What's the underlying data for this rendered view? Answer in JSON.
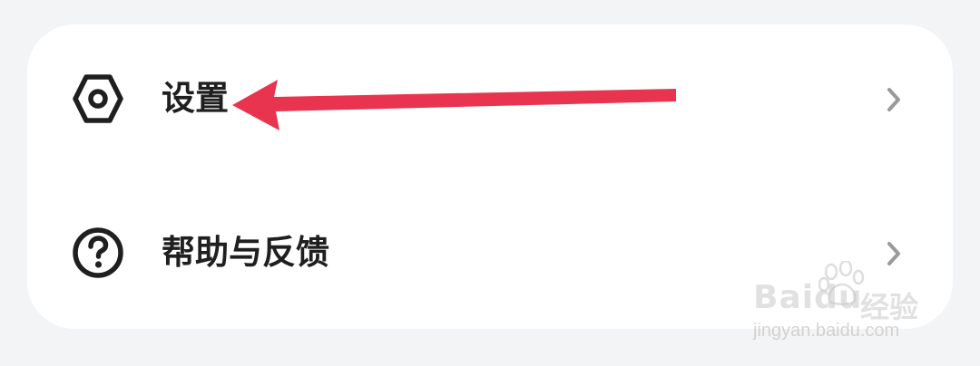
{
  "menu": {
    "items": [
      {
        "label": "设置",
        "icon": "settings-hexagon-icon"
      },
      {
        "label": "帮助与反馈",
        "icon": "help-question-icon"
      }
    ],
    "chevron_icon": "chevron-right-icon"
  },
  "annotation": {
    "arrow_color": "#e8344e"
  },
  "watermark": {
    "brand": "Bai",
    "brand_tail": "du",
    "jingyan": "经验",
    "url": "jingyan.baidu.com"
  },
  "colors": {
    "background": "#f3f4f6",
    "card": "#ffffff",
    "text": "#1f1f1f",
    "chevron": "#9a9a9a"
  }
}
